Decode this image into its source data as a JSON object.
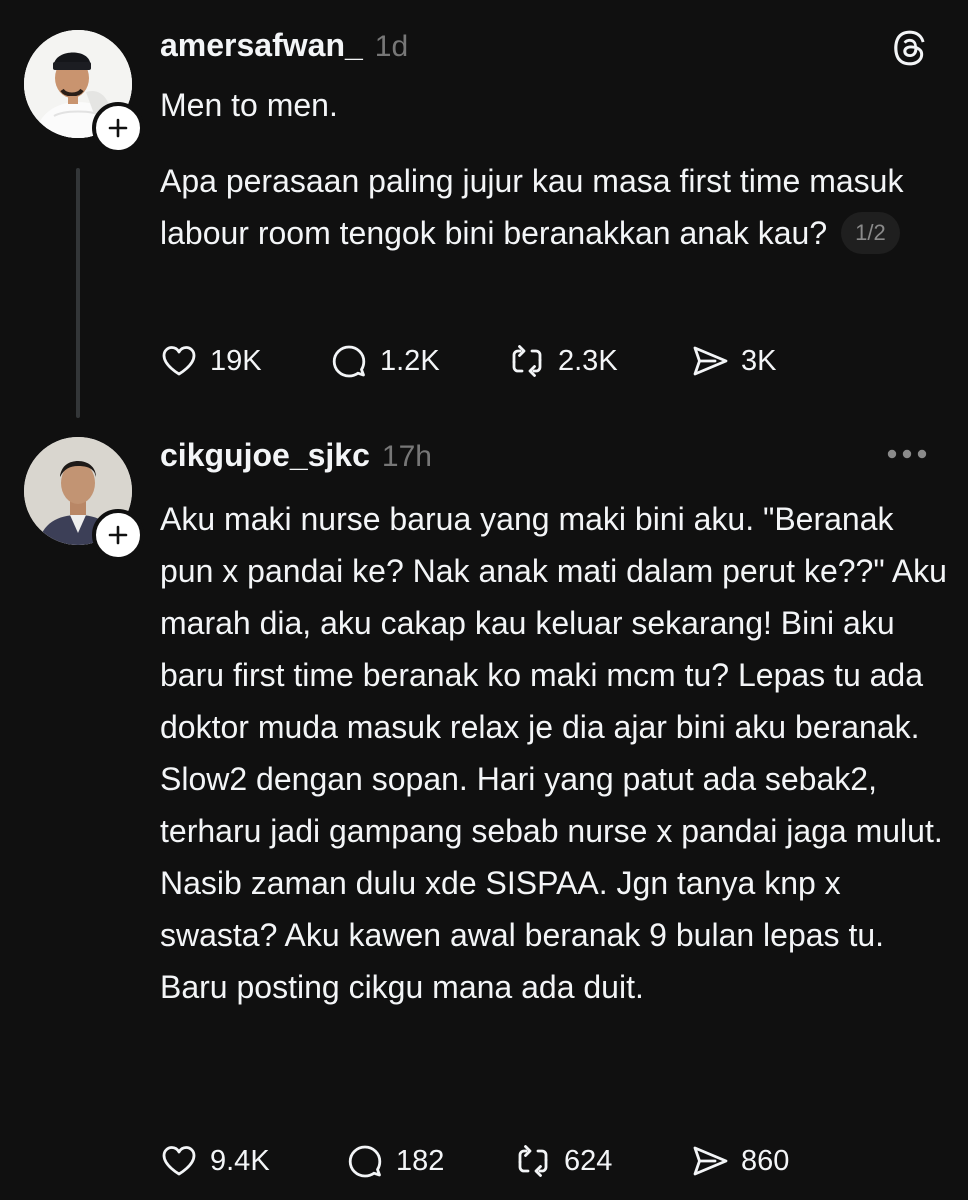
{
  "colors": {
    "background": "#101010",
    "text": "#f3f5f7",
    "muted": "#777777",
    "thread_line": "#333638"
  },
  "icons": {
    "logo": "threads-icon",
    "more": "more-horizontal-icon",
    "follow": "plus-icon",
    "like": "heart-icon",
    "reply": "comment-icon",
    "repost": "repost-icon",
    "share": "send-icon"
  },
  "posts": [
    {
      "username": "amersafwan_",
      "time": "1d",
      "body": [
        "Men to men.",
        "Apa perasaan paling jujur kau masa first time masuk labour room tengok bini beranakkan anak kau?"
      ],
      "page_indicator": "1/2",
      "stats": {
        "likes": "19K",
        "replies": "1.2K",
        "reposts": "2.3K",
        "shares": "3K"
      }
    },
    {
      "username": "cikgujoe_sjkc",
      "time": "17h",
      "body": [
        "Aku maki nurse barua yang maki bini aku. \"Beranak pun x pandai ke? Nak anak mati dalam perut ke??\" Aku marah dia, aku cakap kau keluar sekarang! Bini aku baru first time beranak ko maki mcm tu? Lepas tu ada doktor muda masuk relax je dia ajar bini aku beranak. Slow2 dengan sopan. Hari yang patut ada sebak2, terharu jadi gampang sebab nurse x pandai jaga mulut. Nasib zaman dulu xde SISPAA. Jgn tanya knp x swasta? Aku kawen awal beranak 9 bulan lepas tu. Baru posting cikgu mana ada duit."
      ],
      "stats": {
        "likes": "9.4K",
        "replies": "182",
        "reposts": "624",
        "shares": "860"
      }
    }
  ]
}
